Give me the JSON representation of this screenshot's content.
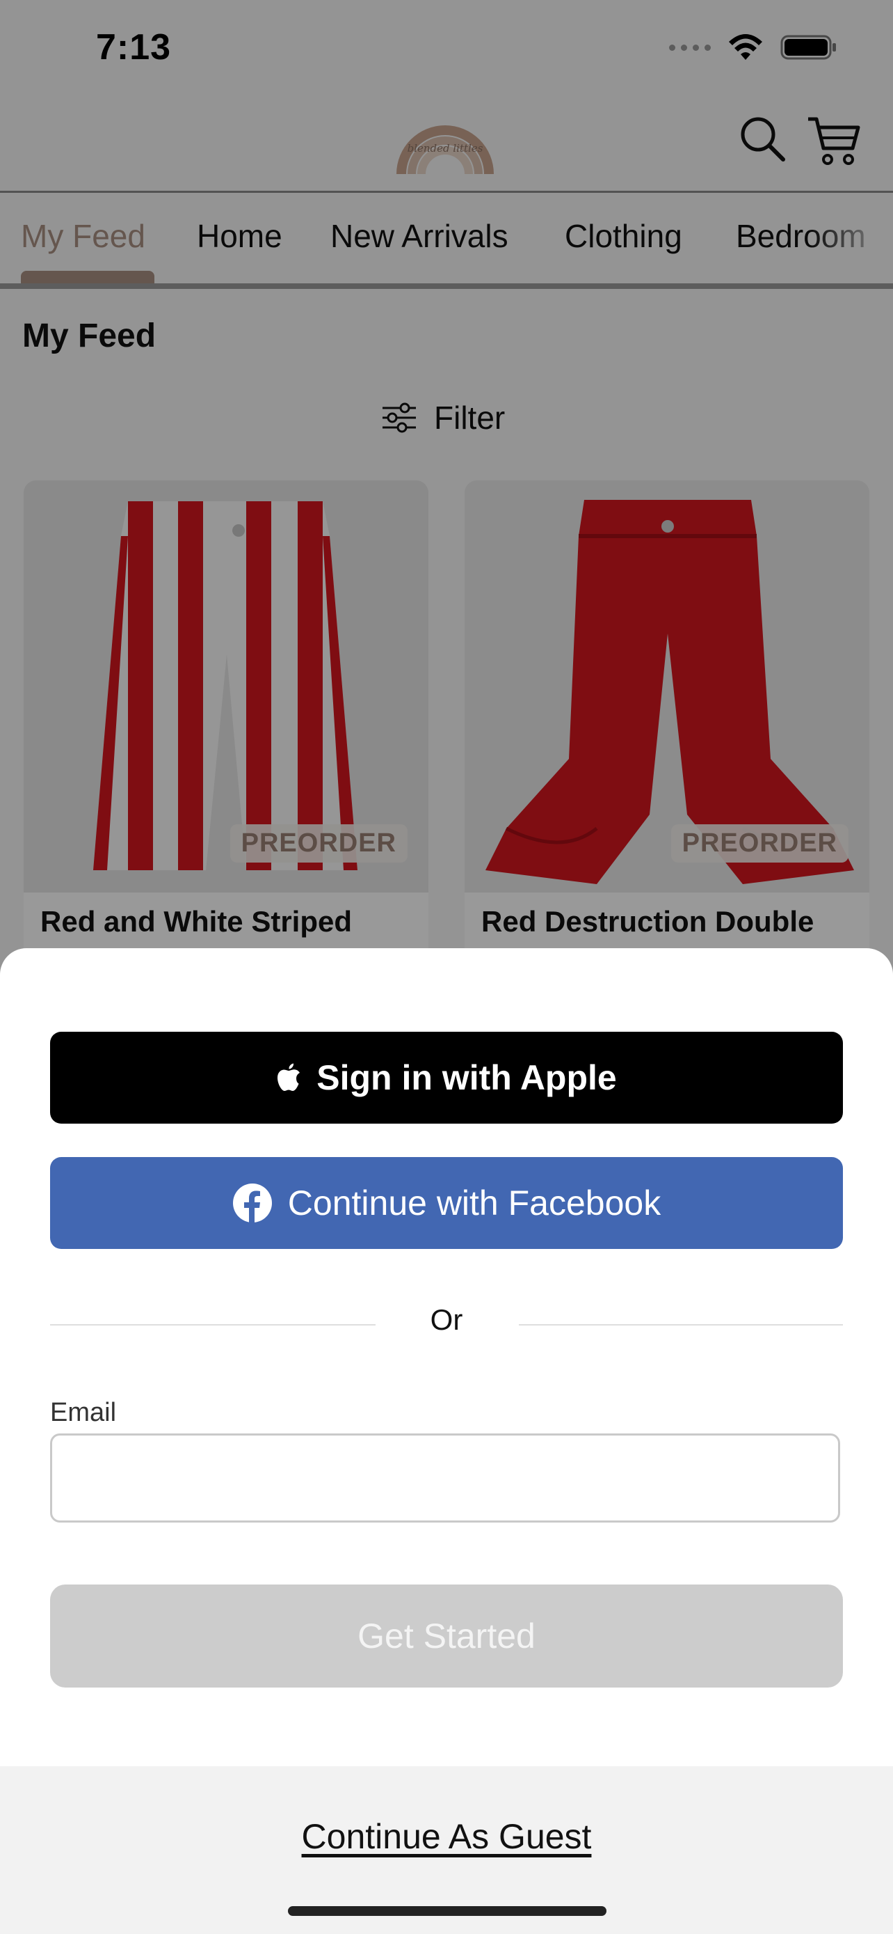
{
  "status_bar": {
    "time": "7:13"
  },
  "header": {
    "logo_icon": "rainbow-logo",
    "logo_text": "blended littles"
  },
  "tabs": [
    {
      "label": "My Feed",
      "active": true
    },
    {
      "label": "Home"
    },
    {
      "label": "New Arrivals"
    },
    {
      "label": "Clothing"
    },
    {
      "label": "Bedroom"
    }
  ],
  "feed": {
    "title": "My Feed",
    "filter_label": "Filter",
    "products": [
      {
        "title": "Red and White Striped",
        "badge": "PREORDER"
      },
      {
        "title": "Red Destruction Double",
        "badge": "PREORDER"
      }
    ]
  },
  "sheet": {
    "apple_label": "Sign in with Apple",
    "facebook_label": "Continue with Facebook",
    "or_label": "Or",
    "email_label": "Email",
    "email_value": "",
    "get_started_label": "Get Started",
    "guest_label": "Continue As Guest"
  },
  "colors": {
    "accent": "#a88f82",
    "facebook": "#4267b2",
    "apple": "#000000",
    "disabled": "#cccccc"
  }
}
